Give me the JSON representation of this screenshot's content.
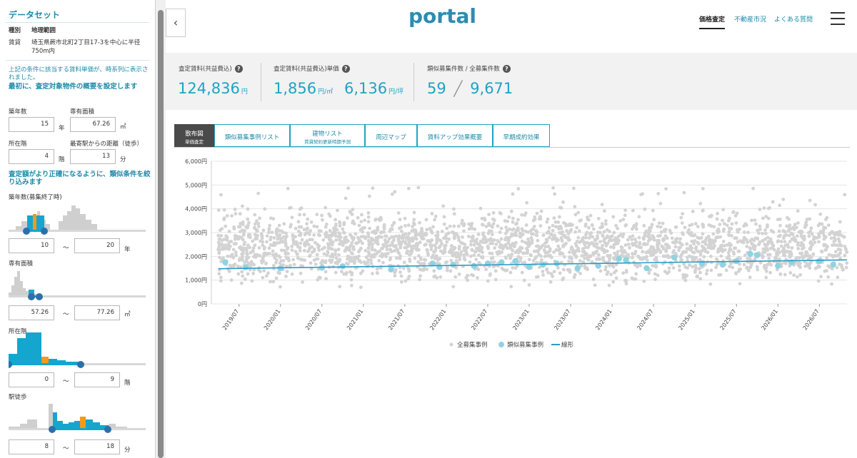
{
  "sidebar": {
    "title": "データセット",
    "header_type": "種別",
    "header_range": "地理範囲",
    "row_type": "賃貸",
    "row_range_line1": "埼玉県蕨市北町2丁目17-3を中心に半径",
    "row_range_line2": "750m内",
    "note": "上記の条件に該当する賃料単価が、時系列に表示されました。",
    "heading_property": "最初に、査定対象物件の概要を設定します",
    "age_label": "築年数",
    "age_value": "15",
    "age_unit": "年",
    "area_label": "専有面積",
    "area_value": "67.26",
    "area_unit": "㎡",
    "floor_label": "所在階",
    "floor_value": "4",
    "floor_unit": "階",
    "walk_label": "最寄駅からの距離（徒歩）",
    "walk_value": "13",
    "walk_unit": "分",
    "heading_filter": "査定額がより正確になるように、類似条件を絞り込みます",
    "filter_age_label": "築年数(募集終了時)",
    "filter_age_min": "10",
    "filter_age_max": "20",
    "filter_age_unit": "年",
    "filter_area_label": "専有面積",
    "filter_area_min": "57.26",
    "filter_area_max": "77.26",
    "filter_area_unit": "㎡",
    "filter_floor_label": "所在階",
    "filter_floor_min": "0",
    "filter_floor_max": "9",
    "filter_floor_unit": "階",
    "filter_walk_label": "駅徒歩",
    "filter_walk_min": "8",
    "filter_walk_max": "18",
    "filter_walk_unit": "分",
    "range_sep": "〜"
  },
  "collapse_icon": "chevron-left-icon",
  "header": {
    "logo": "portal",
    "nav_active": "価格査定",
    "nav_market": "不動産市況",
    "nav_faq": "よくある質問",
    "menu_icon": "hamburger-icon"
  },
  "stats": {
    "rent_label": "査定賃料(共益費込)",
    "rent_value": "124,836",
    "rent_unit": "円",
    "unit_label": "査定賃料(共益費込)単価",
    "unit_sqm_value": "1,856",
    "unit_sqm_unit": "円/㎡",
    "unit_tsubo_value": "6,136",
    "unit_tsubo_unit": "円/坪",
    "count_label": "類似募集件数 / 全募集件数",
    "count_similar": "59",
    "count_sep": "╱",
    "count_total": "9,671",
    "help_glyph": "?"
  },
  "tabs": [
    {
      "label": "散布図",
      "sub": "単価査定"
    },
    {
      "label": "類似募集事例リスト"
    },
    {
      "label": "建物リスト",
      "sub": "賃貸契約更新時期予測"
    },
    {
      "label": "周辺マップ"
    },
    {
      "label": "賃料アップ効果概要"
    },
    {
      "label": "早期成約効果"
    }
  ],
  "colors": {
    "accent": "#1fa3c4",
    "all_points": "#d3d3d3",
    "similar_points": "#8fd3e3",
    "trend": "#2b9cc4",
    "hist_grey": "#cfcfcf",
    "hist_blue": "#14a6cf",
    "hist_orange": "#f29a1f",
    "handle": "#2f6fa8"
  },
  "chart_data": {
    "type": "scatter",
    "ylim": [
      0,
      6000
    ],
    "y_ticks": [
      "0円",
      "1,000円",
      "2,000円",
      "3,000円",
      "4,000円",
      "5,000円",
      "6,000円"
    ],
    "x_ticks": [
      "2019/07",
      "2020/01",
      "2020/07",
      "2021/01",
      "2021/07",
      "2022/01",
      "2022/07",
      "2023/01",
      "2023/07",
      "2024/01",
      "2024/07",
      "2025/01",
      "2025/07",
      "2026/01",
      "2026/07"
    ],
    "xlim": [
      "2019/03",
      "2026/11"
    ],
    "legend": [
      "全募集事例",
      "類似募集事例",
      "線形"
    ],
    "legend_position": "bottom",
    "grid": true,
    "series": [
      {
        "name": "全募集事例",
        "count": 9671,
        "y_center": 2400,
        "y_spread": 1000
      },
      {
        "name": "類似募集事例",
        "points": [
          [
            "2019/05",
            1750
          ],
          [
            "2019/08",
            1550
          ],
          [
            "2020/01",
            1500
          ],
          [
            "2020/07",
            1520
          ],
          [
            "2020/10",
            1580
          ],
          [
            "2021/05",
            1450
          ],
          [
            "2021/11",
            1700
          ],
          [
            "2021/12",
            1550
          ],
          [
            "2022/02",
            1650
          ],
          [
            "2022/05",
            1600
          ],
          [
            "2022/07",
            1700
          ],
          [
            "2022/09",
            1750
          ],
          [
            "2022/11",
            1800
          ],
          [
            "2023/01",
            1550
          ],
          [
            "2023/03",
            1650
          ],
          [
            "2023/05",
            1700
          ],
          [
            "2023/08",
            1500
          ],
          [
            "2023/11",
            1600
          ],
          [
            "2024/02",
            1900
          ],
          [
            "2024/03",
            1850
          ],
          [
            "2024/06",
            1500
          ],
          [
            "2024/10",
            1950
          ],
          [
            "2025/02",
            1700
          ],
          [
            "2025/05",
            1650
          ],
          [
            "2025/07",
            1800
          ],
          [
            "2025/09",
            2100
          ],
          [
            "2025/10",
            2050
          ],
          [
            "2026/01",
            1600
          ],
          [
            "2026/03",
            1750
          ],
          [
            "2026/07",
            1800
          ],
          [
            "2026/09",
            1650
          ]
        ]
      },
      {
        "name": "線形",
        "line": [
          [
            "2019/04",
            1480
          ],
          [
            "2026/11",
            1850
          ]
        ]
      }
    ]
  }
}
